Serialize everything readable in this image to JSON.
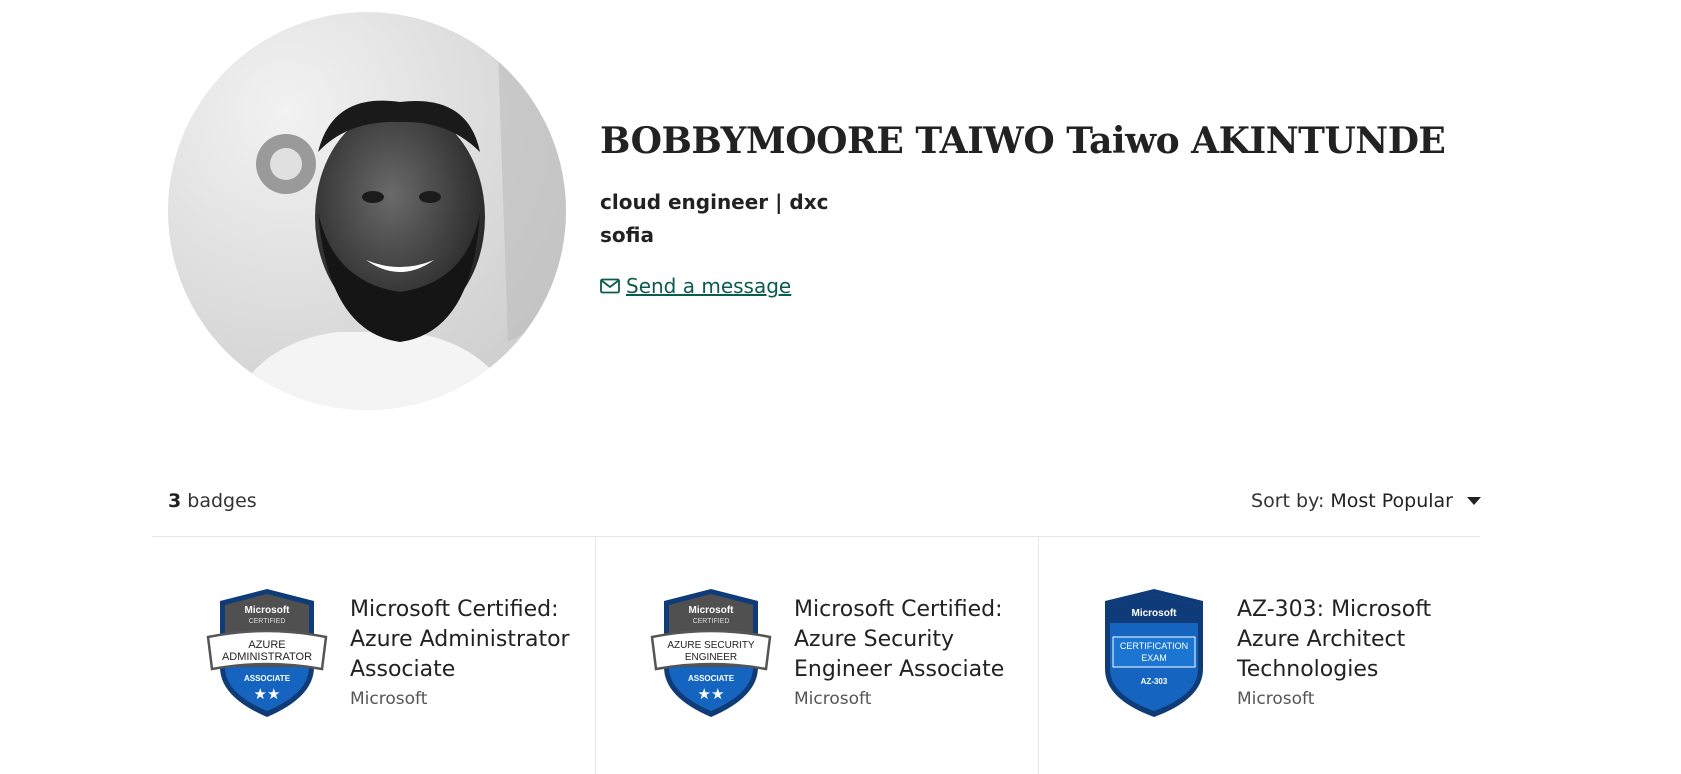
{
  "profile": {
    "name": "BOBBYMOORE TAIWO Taiwo AKINTUNDE",
    "job": "cloud engineer | dxc",
    "location": "sofia",
    "message_link": "Send a message",
    "photo_icon": "avatar-photo"
  },
  "badges_header": {
    "count": "3",
    "count_label": "badges",
    "sort_label": "Sort by:",
    "sort_value": "Most Popular"
  },
  "badges": [
    {
      "title": "Microsoft Certified: Azure Administrator Associate",
      "issuer": "Microsoft",
      "emblem": {
        "top": "Microsoft",
        "sub": "CERTIFIED",
        "ribbon": [
          "AZURE",
          "ADMINISTRATOR"
        ],
        "level": "ASSOCIATE"
      }
    },
    {
      "title": "Microsoft Certified: Azure Security Engineer Associate",
      "issuer": "Microsoft",
      "emblem": {
        "top": "Microsoft",
        "sub": "CERTIFIED",
        "ribbon": [
          "AZURE SECURITY",
          "ENGINEER"
        ],
        "level": "ASSOCIATE"
      }
    },
    {
      "title": "AZ-303: Microsoft Azure Architect Technologies",
      "issuer": "Microsoft",
      "emblem": {
        "top": "Microsoft",
        "box": [
          "CERTIFICATION",
          "EXAM"
        ],
        "code": "AZ-303"
      }
    }
  ],
  "colors": {
    "link": "#0b5c4e",
    "badge_dark": "#0f3c78",
    "badge_blue": "#1565c0",
    "badge_grey": "#505050"
  }
}
